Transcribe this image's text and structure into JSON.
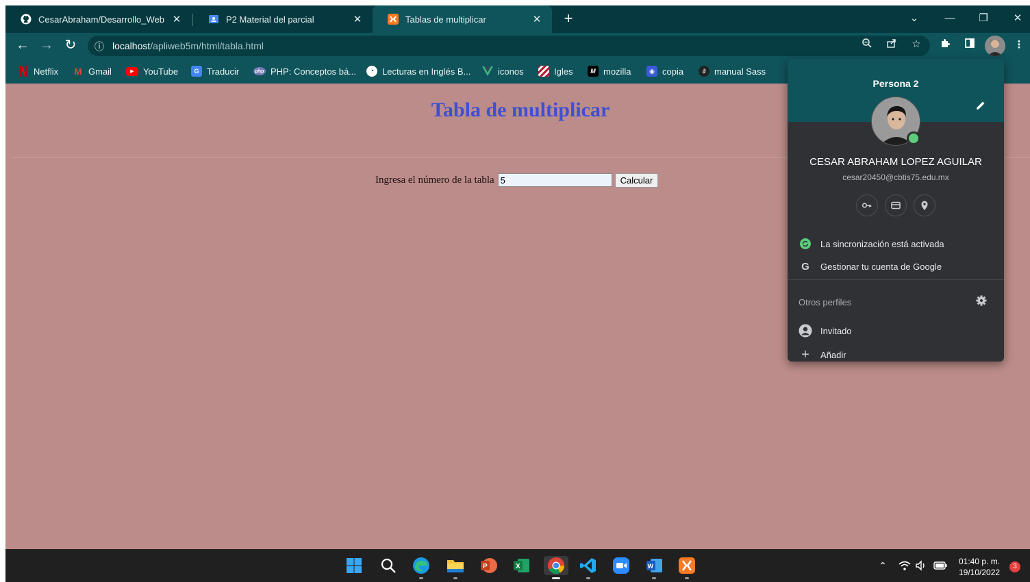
{
  "tabs": [
    {
      "title": "CesarAbraham/Desarrollo_Web",
      "icon": "github-icon",
      "active": false
    },
    {
      "title": "P2 Material del parcial",
      "icon": "classroom-icon",
      "active": false
    },
    {
      "title": "Tablas de multiplicar",
      "icon": "xampp-icon",
      "active": true
    }
  ],
  "window_controls": {
    "tab_search": "⌄",
    "minimize": "—",
    "restore": "❐",
    "close": "✕"
  },
  "toolbar": {
    "url_host": "localhost",
    "url_path": "/apliweb5m/html/tabla.html",
    "info_glyph": "ⓘ"
  },
  "bookmarks": [
    {
      "label": "Netflix",
      "icon": "netflix-icon",
      "color": "#e50914"
    },
    {
      "label": "Gmail",
      "icon": "gmail-icon",
      "color": "#ea4335"
    },
    {
      "label": "YouTube",
      "icon": "youtube-icon",
      "color": "#ff0000"
    },
    {
      "label": "Traducir",
      "icon": "translate-icon",
      "color": "#4285f4"
    },
    {
      "label": "PHP: Conceptos bá...",
      "icon": "php-icon",
      "color": "#777bb3"
    },
    {
      "label": "Lecturas en Inglés B...",
      "icon": "globe-icon",
      "color": "#ffffff"
    },
    {
      "label": "iconos",
      "icon": "vue-icon",
      "color": "#41b883"
    },
    {
      "label": "Igles",
      "icon": "flag-icon",
      "color": "#b22234"
    },
    {
      "label": "mozilla",
      "icon": "mdn-icon",
      "color": "#000000"
    },
    {
      "label": "copia",
      "icon": "copy-icon",
      "color": "#3b5bdb"
    },
    {
      "label": "manual Sass",
      "icon": "sass-icon",
      "color": "#222222"
    }
  ],
  "page": {
    "title": "Tabla de multiplicar",
    "form_label": "Ingresa el número de la tabla",
    "input_value": "5",
    "button_label": "Calcular",
    "title_color": "#3e4fd4",
    "background": "#bc8c8a"
  },
  "profile": {
    "header": "Persona 2",
    "full_name": "CESAR ABRAHAM LOPEZ AGUILAR",
    "email": "cesar20450@cbtis75.edu.mx",
    "sync_text": "La sincronización está activada",
    "manage_text": "Gestionar tu cuenta de Google",
    "others_label": "Otros perfiles",
    "guest_label": "Invitado",
    "add_label": "Añadir",
    "sync_color": "#5ccc7a"
  },
  "taskbar": {
    "apps": [
      "windows-start-icon",
      "search-icon",
      "edge-icon",
      "file-explorer-icon",
      "powerpoint-icon",
      "excel-icon",
      "chrome-icon",
      "vscode-icon",
      "zoom-icon",
      "word-icon",
      "xampp-icon"
    ],
    "time": "01:40 p. m.",
    "date": "19/10/2022",
    "notifications": "3"
  }
}
